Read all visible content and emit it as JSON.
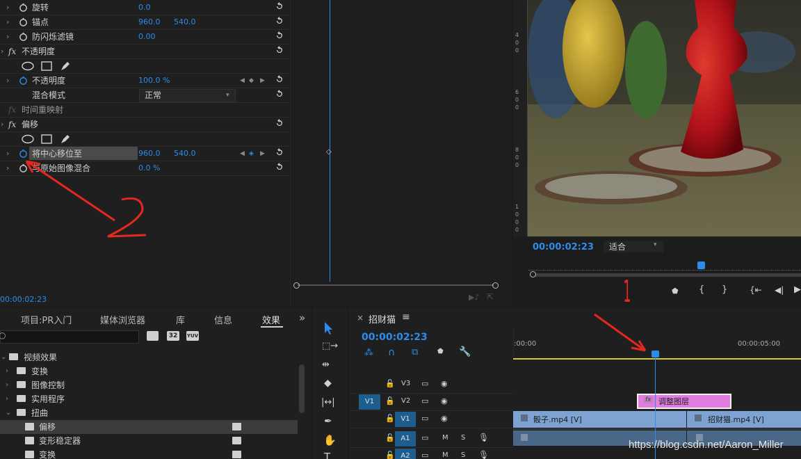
{
  "effect_controls": {
    "rows": [
      {
        "label": "旋转",
        "v1": "0.0"
      },
      {
        "label": "锚点",
        "v1": "960.0",
        "v2": "540.0"
      },
      {
        "label": "防闪烁滤镜",
        "v1": "0.00"
      }
    ],
    "opacity": {
      "title": "不透明度",
      "opacity_label": "不透明度",
      "opacity_value": "100.0 %",
      "blend_label": "混合模式",
      "blend_value": "正常"
    },
    "time_remap": "时间重映射",
    "offset": {
      "title": "偏移",
      "shift_label": "将中心移位至",
      "shift_v1": "960.0",
      "shift_v2": "540.0",
      "blend_label": "与原始图像混合",
      "blend_value": "0.0 %"
    },
    "timecode": "00:00:02:23"
  },
  "annotations": {
    "two": "2",
    "one": "1"
  },
  "program_monitor": {
    "timecode": "00:00:02:23",
    "fit": "适合",
    "ruler_labels": [
      [
        "4",
        "0",
        "0"
      ],
      [
        "6",
        "0",
        "0"
      ],
      [
        "8",
        "0",
        "0"
      ],
      [
        "1",
        "0",
        "0",
        "0"
      ]
    ]
  },
  "project_panel": {
    "tabs": [
      "项目:PR入门",
      "媒体浏览器",
      "库",
      "信息",
      "效果"
    ],
    "more": "»",
    "search_placeholder": "",
    "tree": [
      {
        "label": "视频效果",
        "depth": 0,
        "open": true,
        "icon": "folder"
      },
      {
        "label": "变换",
        "depth": 1,
        "open": false,
        "icon": "folder"
      },
      {
        "label": "图像控制",
        "depth": 1,
        "open": false,
        "icon": "folder"
      },
      {
        "label": "实用程序",
        "depth": 1,
        "open": false,
        "icon": "folder"
      },
      {
        "label": "扭曲",
        "depth": 1,
        "open": true,
        "icon": "folder"
      },
      {
        "label": "偏移",
        "depth": 2,
        "icon": "effect",
        "selected": true
      },
      {
        "label": "变形稳定器",
        "depth": 2,
        "icon": "effect"
      },
      {
        "label": "变换",
        "depth": 2,
        "icon": "effect"
      }
    ]
  },
  "timeline": {
    "close": "×",
    "sequence": "招财猫",
    "menu": "≡",
    "timecode": "00:00:02:23",
    "ruler_start": ":00:00",
    "ruler_mid": "00:00:05:00",
    "tracks": [
      {
        "name": "V3",
        "target": ""
      },
      {
        "name": "V2",
        "target": "V1"
      },
      {
        "name": "V1",
        "target": "",
        "active": true
      },
      {
        "name": "A1",
        "target": "",
        "audio": true,
        "active": true
      },
      {
        "name": "A2",
        "target": "",
        "audio": true,
        "active": true
      }
    ],
    "m": "M",
    "s": "S",
    "clips": {
      "adjust": "调整图层",
      "dice": "骰子.mp4 [V]",
      "cat": "招财猫.mp4 [V]",
      "fx": "fx"
    }
  },
  "watermark": "https://blog.csdn.net/Aaron_Miller",
  "colors": {
    "accent": "#2d8ceb",
    "annotation": "#e5281f",
    "adjust_clip": "#e07ddf",
    "video_clip": "#7ea3d3",
    "playhead": "#2d8ceb",
    "work_area": "#d8c73a"
  }
}
